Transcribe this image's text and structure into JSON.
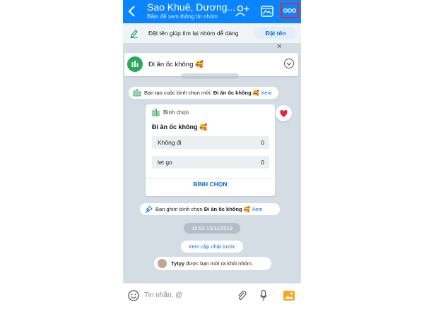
{
  "header": {
    "title": "Sao Khuê, Dương...",
    "subtitle": "Bấm để xem thông tin nhóm"
  },
  "suggestion": {
    "text": "Đặt tên giúp tìm lại nhóm dễ dàng",
    "button": "Đặt tên"
  },
  "pinned_poll": {
    "text": "Đi ăn ốc không 🥰"
  },
  "messages": {
    "poll_created_prefix": "Bạn tạo cuộc bình chọn mới: ",
    "poll_created_title": "Đi ăn ốc không 🥰",
    "poll_created_link": "Xem",
    "poll_pinned_prefix": "Bạn ghim bình chọn ",
    "poll_pinned_title": "Đi ăn ốc không 🥰",
    "poll_pinned_link": "Xem",
    "timestamp": "16:53 13/11/2019",
    "see_earlier": "Xem cập nhật trước",
    "left_name": "Tytyy",
    "left_text": " được bạn mời ra khỏi nhóm."
  },
  "poll": {
    "label": "Bình chọn",
    "title": "Đi ăn ốc không 🥰",
    "options": [
      {
        "name": "Không đi",
        "count": "0"
      },
      {
        "name": "let go",
        "count": "0"
      }
    ],
    "vote_button": "BÌNH CHỌN"
  },
  "input": {
    "placeholder": "Tin nhắn, @"
  },
  "colors": {
    "header": "#0a84ff",
    "accent": "#0a6ed1",
    "highlight": "#e3262f",
    "poll_icon": "#2ca85e"
  }
}
